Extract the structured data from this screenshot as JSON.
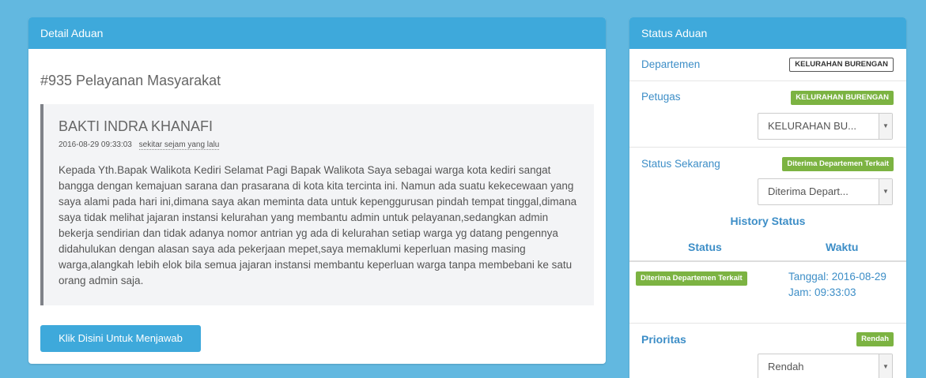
{
  "detail": {
    "heading": "Detail Aduan",
    "title": "#935 Pelayanan Masyarakat",
    "author": "BAKTI INDRA KHANAFI",
    "datetime": "2016-08-29 09:33:03",
    "relative_time": "sekitar sejam yang lalu",
    "body": "Kepada Yth.Bapak Walikota Kediri Selamat Pagi Bapak Walikota Saya sebagai warga kota kediri sangat bangga dengan kemajuan sarana dan prasarana di kota kita tercinta ini. Namun ada suatu kekecewaan yang saya alami pada hari ini,dimana saya akan meminta data untuk kepenggurusan pindah tempat tinggal,dimana saya tidak melihat jajaran instansi kelurahan yang membantu admin untuk pelayanan,sedangkan admin bekerja sendirian dan tidak adanya nomor antrian yg ada di kelurahan setiap warga yg datang pengennya didahulukan dengan alasan saya ada pekerjaan mepet,saya memaklumi keperluan masing masing warga,alangkah lebih elok bila semua jajaran instansi membantu keperluan warga tanpa membebani ke satu orang admin saja.",
    "reply_button": "Klik Disini Untuk Menjawab"
  },
  "status": {
    "heading": "Status Aduan",
    "departemen_label": "Departemen",
    "departemen_badge": "KELURAHAN BURENGAN",
    "petugas_label": "Petugas",
    "petugas_badge": "KELURAHAN BURENGAN",
    "petugas_select": "KELURAHAN BU...",
    "status_label": "Status Sekarang",
    "status_badge": "Diterima Departemen Terkait",
    "status_select": "Diterima Depart...",
    "history_title": "History Status",
    "history_col_status": "Status",
    "history_col_time": "Waktu",
    "history": [
      {
        "status": "Diterima Departemen Terkait",
        "time_line1": "Tanggal: 2016-08-29",
        "time_line2": "Jam: 09:33:03"
      }
    ],
    "prioritas_label": "Prioritas",
    "prioritas_badge": "Rendah",
    "prioritas_select": "Rendah"
  },
  "colors": {
    "accent": "#3ea9db",
    "badge_green": "#7cb342",
    "background": "#62b8e0"
  }
}
